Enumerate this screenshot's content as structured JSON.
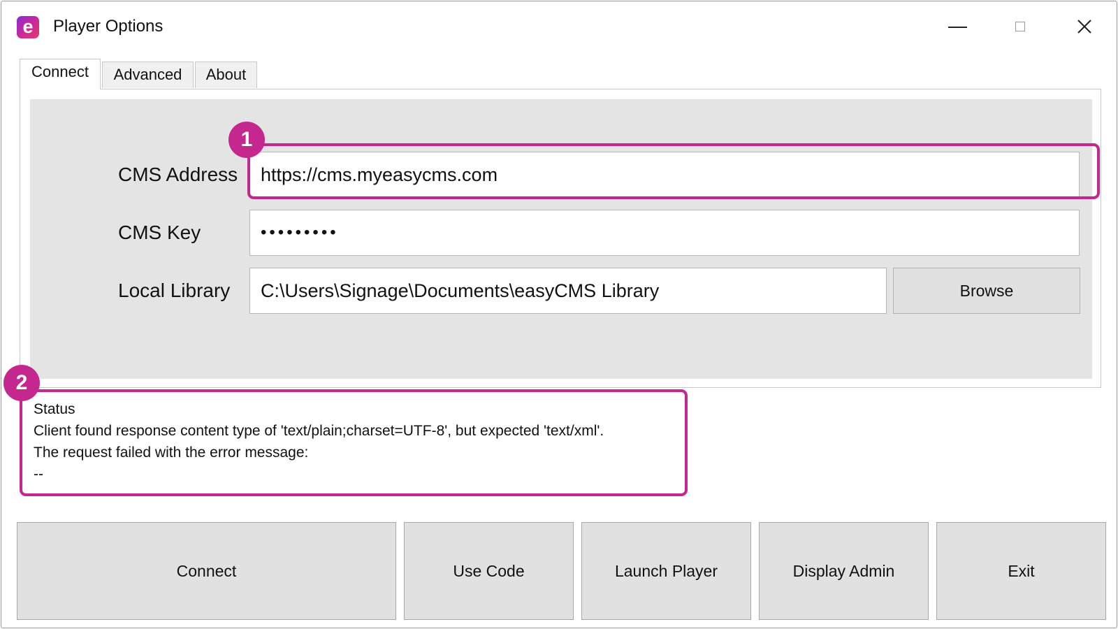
{
  "window": {
    "title": "Player Options",
    "app_icon_letter": "e",
    "app_icon_name": "easycms-app-icon",
    "controls": [
      "minimize-icon",
      "maximize-icon",
      "close-icon"
    ]
  },
  "tabs": [
    {
      "label": "Connect",
      "active": true
    },
    {
      "label": "Advanced",
      "active": false
    },
    {
      "label": "About",
      "active": false
    }
  ],
  "form": {
    "cms_address_label": "CMS Address",
    "cms_address_value": "https://cms.myeasycms.com",
    "cms_key_label": "CMS Key",
    "cms_key_value": "•••••••••",
    "local_library_label": "Local Library",
    "local_library_value": "C:\\Users\\Signage\\Documents\\easyCMS Library",
    "browse_label": "Browse"
  },
  "status": {
    "heading": "Status",
    "line1": "Client found response content type of 'text/plain;charset=UTF-8', but expected 'text/xml'.",
    "line2": "The request failed with the error message:",
    "line3": "--"
  },
  "callouts": {
    "one": "1",
    "two": "2",
    "color": "#c4288e"
  },
  "buttons": {
    "connect": "Connect",
    "use_code": "Use Code",
    "launch_player": "Launch Player",
    "display_admin": "Display Admin",
    "exit": "Exit"
  }
}
